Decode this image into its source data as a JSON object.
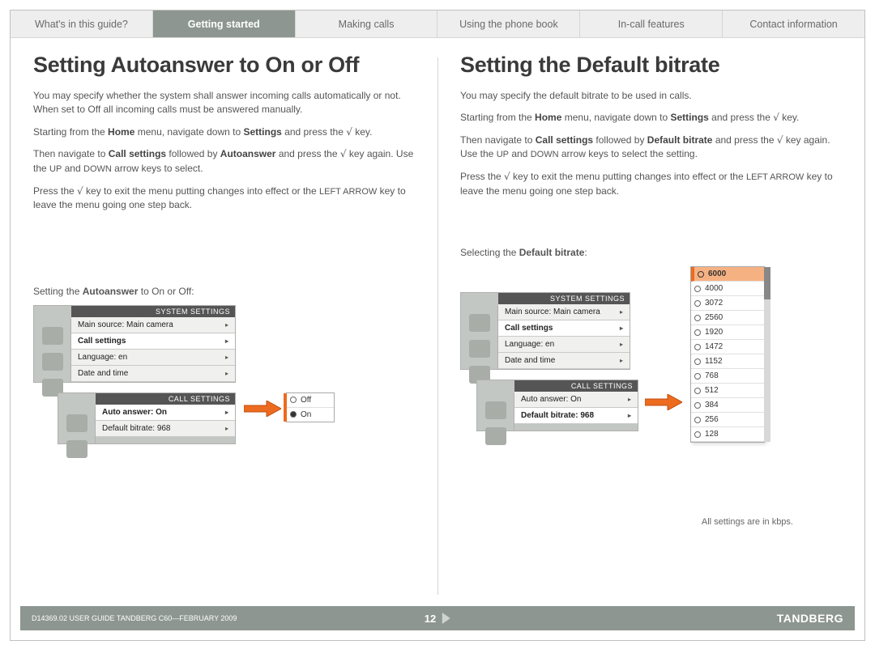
{
  "tabs": [
    {
      "label": "What's in this guide?"
    },
    {
      "label": "Getting started",
      "active": true
    },
    {
      "label": "Making calls"
    },
    {
      "label": "Using the phone book"
    },
    {
      "label": "In-call features"
    },
    {
      "label": "Contact information"
    }
  ],
  "left": {
    "heading": "Setting Autoanswer to On or Off",
    "paras": [
      "You may specify whether the system shall answer incoming calls automatically or not. When set to Off all incoming calls must be answered manually.",
      "Starting from the Home menu, navigate down to Settings and press the √ key.",
      "Then navigate to Call settings followed by Autoanswer and press the √ key again. Use the UP and DOWN arrow keys to select.",
      "Press the √ key to exit the menu putting changes into effect or the LEFT ARROW key to leave the menu going one step back."
    ],
    "caption_a": "Setting the ",
    "caption_b": "Autoanswer",
    "caption_c": " to On or Off:",
    "system_settings_label": "SYSTEM SETTINGS",
    "menu_rows": [
      "Main source: Main camera",
      "Call settings",
      "Language: en",
      "Date and time"
    ],
    "call_settings_label": "CALL SETTINGS",
    "call_rows": [
      "Auto answer: On",
      "Default bitrate: 968"
    ],
    "popup": [
      "Off",
      "On"
    ]
  },
  "right": {
    "heading": "Setting the Default bitrate",
    "paras": [
      "You may specify the default bitrate to be used in calls.",
      "Starting from the Home menu, navigate down to Settings and press the √ key.",
      "Then navigate to Call settings followed by Default bitrate and press the √ key again. Use the UP and DOWN arrow keys to select the setting.",
      "Press the √ key to exit the menu putting changes into effect or the LEFT ARROW key to leave the menu going one step back."
    ],
    "caption_a": "Selecting the ",
    "caption_b": "Default bitrate",
    "caption_c": ":",
    "note": "All settings are in kbps.",
    "system_settings_label": "SYSTEM SETTINGS",
    "menu_rows": [
      "Main source: Main camera",
      "Call settings",
      "Language: en",
      "Date and time"
    ],
    "call_settings_label": "CALL SETTINGS",
    "call_rows": [
      "Auto answer: On",
      "Default bitrate: 968"
    ],
    "bitrate_options": [
      "6000",
      "4000",
      "3072",
      "2560",
      "1920",
      "1472",
      "1152",
      "768",
      "512",
      "384",
      "256",
      "128"
    ]
  },
  "footer": {
    "doc": "D14369.02 USER GUIDE TANDBERG C60—FEBRUARY 2009",
    "page": "12",
    "brand": "TANDBERG"
  }
}
